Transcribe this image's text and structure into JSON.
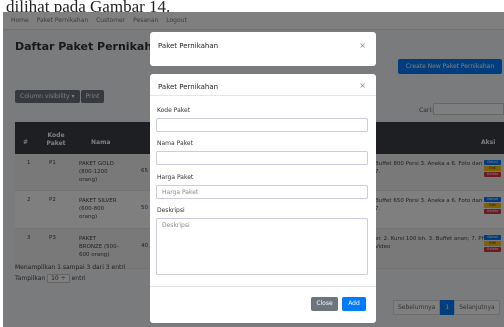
{
  "doc_caption": "dilihat pada Gambar 14.",
  "nav": [
    "Home",
    "Paket Pernikahan",
    "Customer",
    "Pesanan",
    "Logout"
  ],
  "page_title": "Daftar Paket Pernikahan",
  "create_button": "Create New Paket Pernikahan",
  "toolbar": {
    "column_visibility": "Column visibility ▾",
    "print": "Print"
  },
  "search_label": "Cari:",
  "table": {
    "headers": {
      "no": "#",
      "kode": "Kode Paket",
      "nama": "Nama",
      "aksi": "Aksi"
    },
    "rows": [
      {
        "no": "1",
        "kode": "P1",
        "nama": "PAKET GOLD (800-1200 orang)",
        "harga": "65",
        "desc": "Buffet 800 Porsi 3. Aneka a 6. Foto dan video 7."
      },
      {
        "no": "2",
        "kode": "P2",
        "nama": "PAKET SILVER (600-800 orang)",
        "harga": "50",
        "desc": "Buffet 650 Porsi 3. Aneka a 6. Foto dan video 7."
      },
      {
        "no": "3",
        "kode": "P3",
        "nama": "PAKET BRONZE (500-600 orang)",
        "harga": "40",
        "desc": "er. 2. Kursi 100 bh. 3. Buffet anan; 7. Photo & Video"
      }
    ],
    "actions": {
      "detail": "Detail",
      "edit": "Edit",
      "delete": "Delete"
    }
  },
  "info": "Menampilkan 1 sampai 3 dari 3 entri",
  "show": {
    "prefix": "Tampilkan",
    "value": "10 ÷",
    "suffix": "entri"
  },
  "pager": {
    "prev": "Sebelumnya",
    "current": "1",
    "next": "Selanjutnya"
  },
  "modal_back": {
    "title": "Paket Pernikahan",
    "close": "×"
  },
  "modal": {
    "title": "Paket Pernikahan",
    "close": "×",
    "kode_label": "Kode Paket",
    "kode_value": "",
    "nama_label": "Nama Paket",
    "nama_value": "",
    "harga_label": "Harga Paket",
    "harga_placeholder": "Harga Paket",
    "desk_label": "Deskripsi",
    "desk_placeholder": "Deskripsi",
    "close_button": "Close",
    "add_button": "Add"
  },
  "colors": {
    "primary": "#007bff",
    "secondary": "#6c757d",
    "table_head": "#3a3f44"
  }
}
